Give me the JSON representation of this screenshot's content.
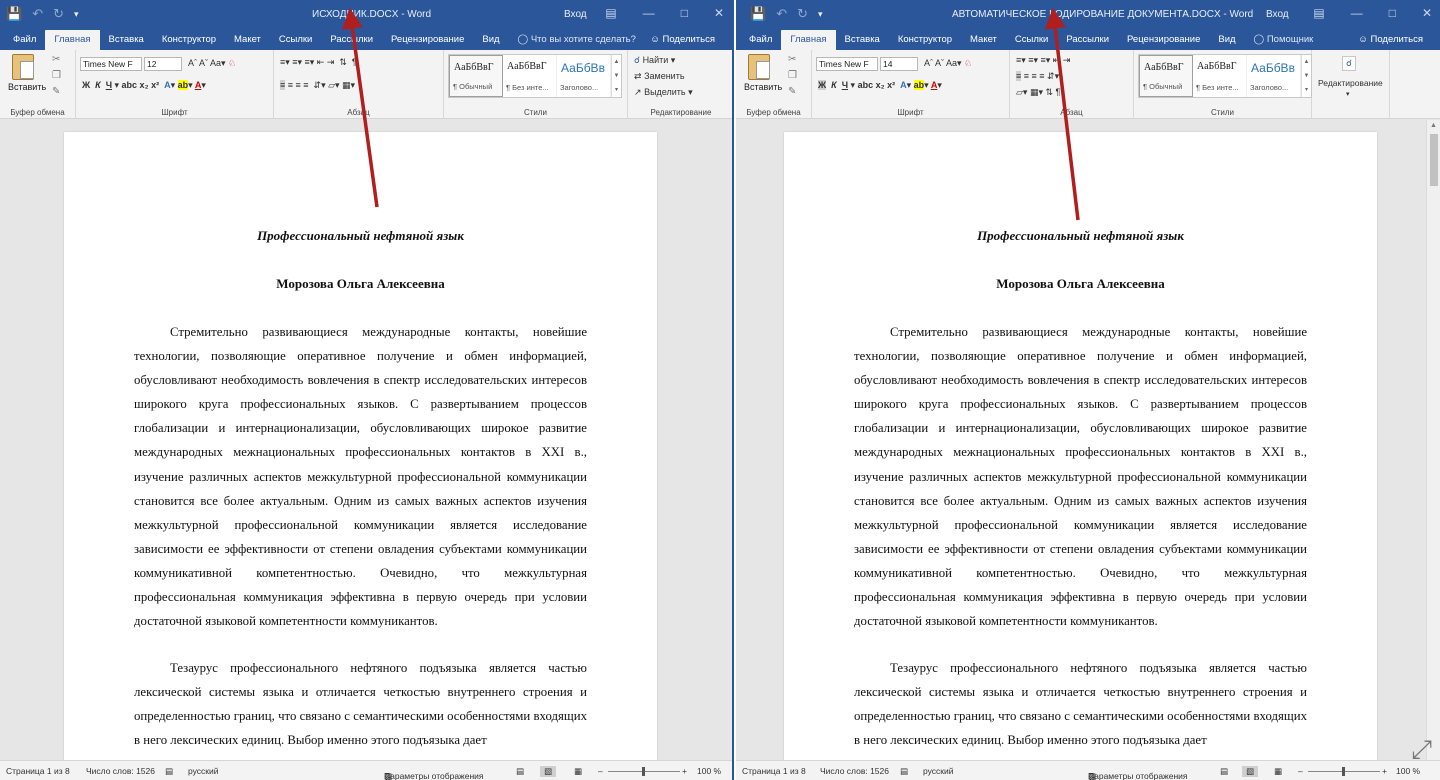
{
  "left": {
    "title": "ИСХОДНИК.DOCX - Word",
    "login": "Вход",
    "tabs": [
      "Файл",
      "Главная",
      "Вставка",
      "Конструктор",
      "Макет",
      "Ссылки",
      "Рассылки",
      "Рецензирование",
      "Вид"
    ],
    "tell_me": "Что вы хотите сделать?",
    "share": "Поделиться",
    "font_name": "Times New F",
    "font_size": "12",
    "groups": {
      "clipboard": "Буфер обмена",
      "font": "Шрифт",
      "paragraph": "Абзац",
      "styles": "Стили",
      "editing": "Редактирование"
    },
    "paste": "Вставить",
    "edit": {
      "find": "Найти",
      "replace": "Заменить",
      "select": "Выделить"
    },
    "status": {
      "page": "Страница 1 из 8",
      "words": "Число слов: 1526",
      "lang": "русский",
      "display": "Параметры отображения",
      "zoom": "100 %"
    }
  },
  "right": {
    "title": "АВТОМАТИЧЕСКОЕ КОДИРОВАНИЕ ДОКУМЕНТА.DOCX - Word",
    "login": "Вход",
    "tabs": [
      "Файл",
      "Главная",
      "Вставка",
      "Конструктор",
      "Макет",
      "Ссылки",
      "Рассылки",
      "Рецензирование",
      "Вид"
    ],
    "tell_me": "Помощник",
    "share": "Поделиться",
    "font_name": "Times New F",
    "font_size": "14",
    "groups": {
      "clipboard": "Буфер обмена",
      "font": "Шрифт",
      "paragraph": "Абзац",
      "styles": "Стили"
    },
    "paste": "Вставить",
    "editing_btn": "Редактирование",
    "status": {
      "page": "Страница 1 из 8",
      "words": "Число слов: 1526",
      "lang": "русский",
      "display": "Параметры отображения",
      "zoom": "100 %"
    }
  },
  "styles": [
    {
      "sample": "АаБбВвГ",
      "name": "¶ Обычный"
    },
    {
      "sample": "АаБбВвГ",
      "name": "¶ Без инте..."
    },
    {
      "sample": "АаБбВв",
      "name": "Заголово..."
    }
  ],
  "document": {
    "title": "Профессиональный нефтяной язык",
    "author": "Морозова Ольга Алексеевна",
    "p1": "Стремительно развивающиеся международные контакты, новейшие технологии, позволяющие оперативное получение и обмен информацией, обусловливают необходимость вовлечения в спектр исследовательских интересов широкого круга профессиональных языков. С развертыванием процессов глобализации и интернационализации, обусловливающих широкое развитие международных межнациональных профессиональных контактов в XXI в., изучение различных аспектов межкультурной профессиональной коммуникации становится все более актуальным. Одним из самых важных аспектов изучения межкультурной профессиональной коммуникации является исследование зависимости ее эффективности от степени овладения субъектами коммуникации коммуникативной компетентностью. Очевидно, что межкультурная профессиональная коммуникация эффективна в первую очередь при условии достаточной языковой компетентности коммуникантов.",
    "p2": "Тезаурус профессионального нефтяного подъязыка является частью лексической системы языка и отличается четкостью внутреннего строения и определенностью границ, что связано с семантическими особенностями входящих в него лексических единиц. Выбор именно этого подъязыка дает"
  },
  "colors": {
    "word_blue": "#2b579a",
    "arrow": "#b01e1e"
  }
}
